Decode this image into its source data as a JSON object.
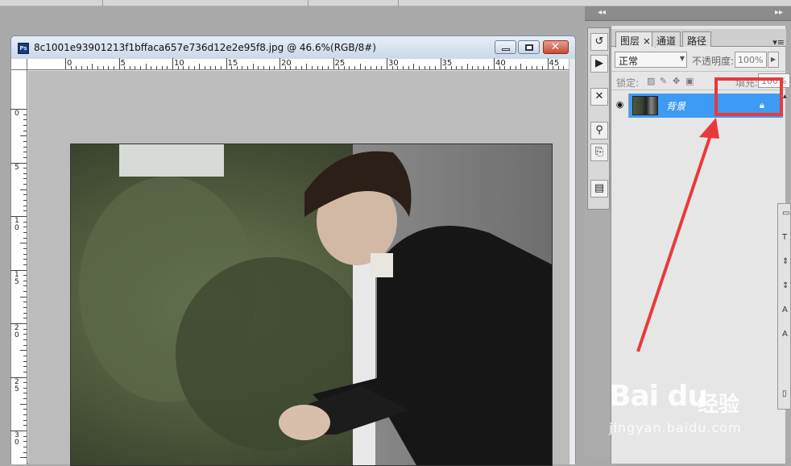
{
  "document": {
    "title": "8c1001e93901213f1bffaca657e736d12e2e95f8.jpg @ 46.6%(RGB/8#)",
    "app_icon": "Ps",
    "minimize_icon": "minimize-icon",
    "maximize_icon": "maximize-icon",
    "close_icon": "close-icon",
    "close_glyph": "✕",
    "h_ruler_labels": [
      "0",
      "5",
      "10",
      "15",
      "20",
      "25",
      "30",
      "35",
      "40",
      "45"
    ],
    "v_ruler_labels": [
      "0",
      "5",
      "1\n0",
      "1\n5",
      "2\n0",
      "2\n5",
      "3\n0"
    ]
  },
  "dock": {
    "collapse_glyph": "◂◂",
    "expand_glyph": "▸▸"
  },
  "layers_panel": {
    "tabs": [
      "图层",
      "通道",
      "路径"
    ],
    "tab_close": "×",
    "menu_glyph": "▾≡",
    "blend_mode": "正常",
    "opacity_label": "不透明度:",
    "opacity_value": "100%",
    "lock_label": "锁定:",
    "fill_label": "填充:",
    "fill_value": "100%",
    "layer": {
      "name": "背景",
      "visible_icon": "eye-icon",
      "lock_icon": "lock-icon"
    }
  },
  "annotation": {
    "highlight_color": "#e83a3a"
  },
  "watermark": {
    "brand": "Bai du",
    "brand_cn": "经验",
    "url": "jingyan.baidu.com"
  }
}
